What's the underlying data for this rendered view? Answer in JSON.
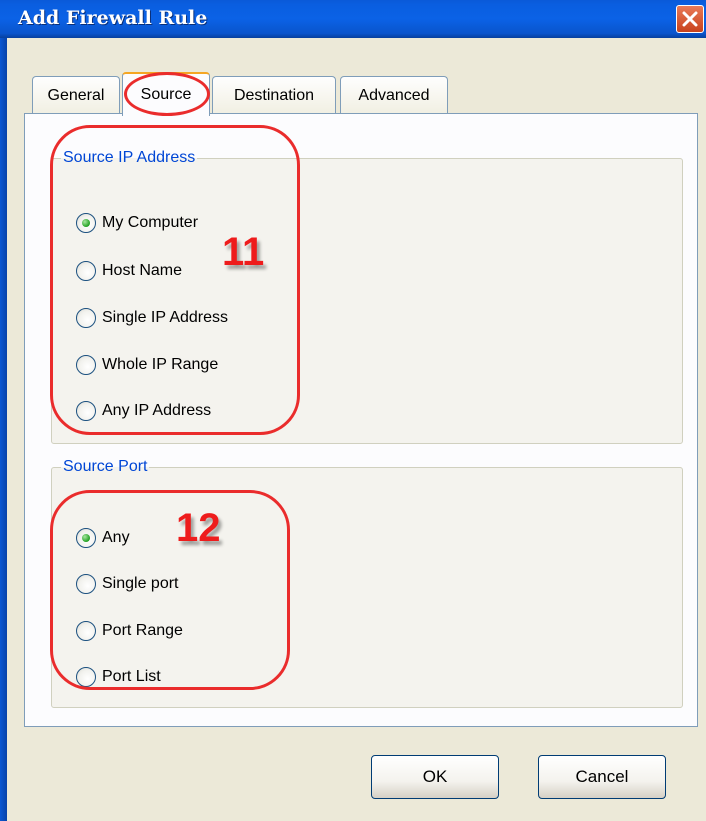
{
  "window": {
    "title": "Add Firewall Rule",
    "close_icon": "close-icon",
    "accent_color": "#0a5ee0",
    "close_color": "#d9532c"
  },
  "tabs": [
    {
      "label": "General",
      "active": false
    },
    {
      "label": "Source",
      "active": true
    },
    {
      "label": "Destination",
      "active": false
    },
    {
      "label": "Advanced",
      "active": false
    }
  ],
  "source_ip": {
    "legend": "Source IP Address",
    "options": [
      {
        "label": "My Computer",
        "selected": true
      },
      {
        "label": "Host Name",
        "selected": false
      },
      {
        "label": "Single IP Address",
        "selected": false
      },
      {
        "label": "Whole IP Range",
        "selected": false
      },
      {
        "label": "Any IP Address",
        "selected": false
      }
    ]
  },
  "source_port": {
    "legend": "Source Port",
    "options": [
      {
        "label": "Any",
        "selected": true
      },
      {
        "label": "Single port",
        "selected": false
      },
      {
        "label": "Port Range",
        "selected": false
      },
      {
        "label": "Port List",
        "selected": false
      }
    ]
  },
  "annotations": {
    "marker_ip": "11",
    "marker_port": "12",
    "color": "#e8262a"
  },
  "buttons": {
    "ok": "OK",
    "cancel": "Cancel"
  }
}
